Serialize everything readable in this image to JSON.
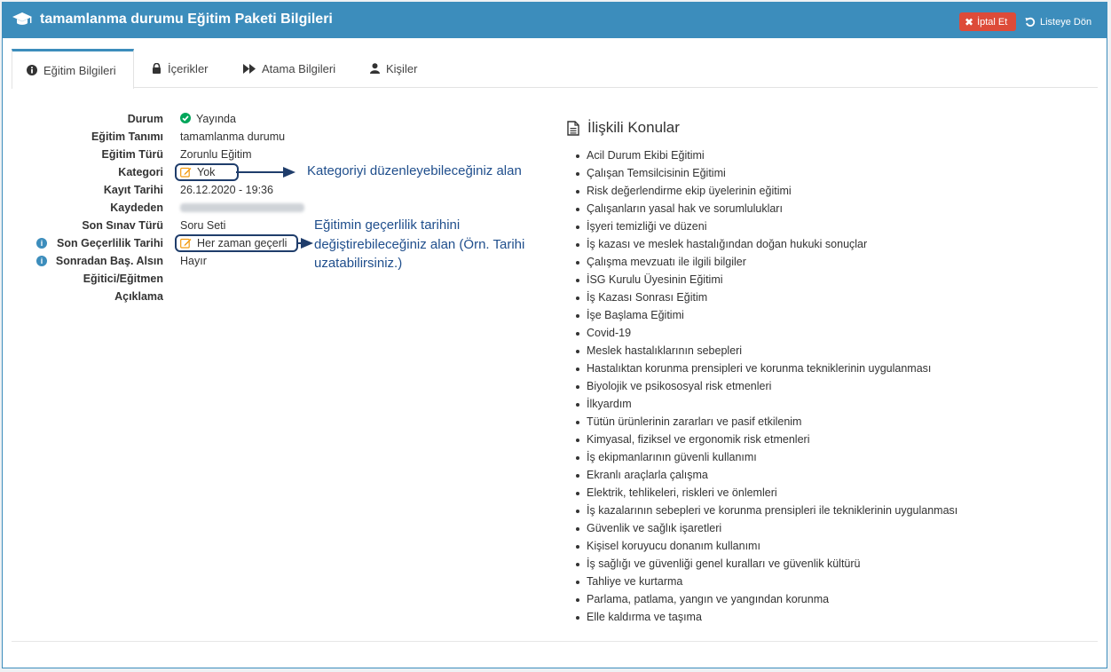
{
  "header": {
    "title": "tamamlanma durumu Eğitim Paketi Bilgileri",
    "title_icon": "graduation-cap-icon",
    "cancel_label": "İptal Et",
    "back_label": "Listeye Dön"
  },
  "tabs": [
    {
      "label": "Eğitim Bilgileri",
      "icon": "info-circle-icon",
      "active": true
    },
    {
      "label": "İçerikler",
      "icon": "lock-icon",
      "active": false
    },
    {
      "label": "Atama Bilgileri",
      "icon": "fast-forward-icon",
      "active": false
    },
    {
      "label": "Kişiler",
      "icon": "user-icon",
      "active": false
    }
  ],
  "details": {
    "durum_label": "Durum",
    "durum_value": "Yayında",
    "tanim_label": "Eğitim Tanımı",
    "tanim_value": "tamamlanma durumu",
    "tur_label": "Eğitim Türü",
    "tur_value": "Zorunlu Eğitim",
    "kategori_label": "Kategori",
    "kategori_value": "Yok",
    "kayit_label": "Kayıt Tarihi",
    "kayit_value": "26.12.2020 - 19:36",
    "kaydeden_label": "Kaydeden",
    "sinav_label": "Son Sınav Türü",
    "sinav_value": "Soru Seti",
    "gecerlilik_label": "Son Geçerlilik Tarihi",
    "gecerlilik_value": "Her zaman geçerli",
    "sonradan_label": "Sonradan Baş. Alsın",
    "sonradan_value": "Hayır",
    "egitici_label": "Eğitici/Eğitmen",
    "aciklama_label": "Açıklama"
  },
  "annotations": {
    "kategori_note": "Kategoriyi düzenleyebileceğiniz alan",
    "gecerlilik_note_1": "Eğitimin geçerlilik tarihini",
    "gecerlilik_note_2": "değiştirebileceğiniz alan (Örn. Tarihi",
    "gecerlilik_note_3": "uzatabilirsiniz.)"
  },
  "topics": {
    "heading": "İlişkili Konular",
    "items": [
      "Acil Durum Ekibi Eğitimi",
      "Çalışan Temsilcisinin Eğitimi",
      "Risk değerlendirme ekip üyelerinin eğitimi",
      "Çalışanların yasal hak ve sorumlulukları",
      "İşyeri temizliği ve düzeni",
      "İş kazası ve meslek hastalığından doğan hukuki sonuçlar",
      "Çalışma mevzuatı ile ilgili bilgiler",
      "İSG Kurulu Üyesinin Eğitimi",
      "İş Kazası Sonrası Eğitim",
      "İşe Başlama Eğitimi",
      "Covid-19",
      "Meslek hastalıklarının sebepleri",
      "Hastalıktan korunma prensipleri ve korunma tekniklerinin uygulanması",
      "Biyolojik ve psikososyal risk etmenleri",
      "İlkyardım",
      "Tütün ürünlerinin zararları ve pasif etkilenim",
      "Kimyasal, fiziksel ve ergonomik risk etmenleri",
      "İş ekipmanlarının güvenli kullanımı",
      "Ekranlı araçlarla çalışma",
      "Elektrik, tehlikeleri, riskleri ve önlemleri",
      "İş kazalarının sebepleri ve korunma prensipleri ile tekniklerinin uygulanması",
      "Güvenlik ve sağlık işaretleri",
      "Kişisel koruyucu donanım kullanımı",
      "İş sağlığı ve güvenliği genel kuralları ve güvenlik kültürü",
      "Tahliye ve kurtarma",
      "Parlama, patlama, yangın ve yangından korunma",
      "Elle kaldırma ve taşıma"
    ]
  },
  "colors": {
    "header_bg": "#3c8dbc",
    "cancel_bg": "#dd4b39",
    "status_ok": "#00a65a",
    "annotation": "#1f4e8c",
    "edit_icon": "#f39c12"
  }
}
